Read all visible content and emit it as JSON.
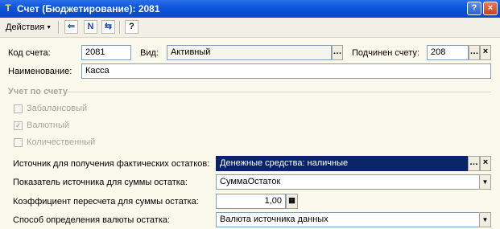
{
  "window": {
    "title": "Счет (Бюджетирование): 2081",
    "app_icon": "1C-app-icon"
  },
  "toolbar": {
    "actions_label": "Действия",
    "icons": [
      "back-icon",
      "structure-icon",
      "switch-icon",
      "help-icon"
    ],
    "help_glyph": "?"
  },
  "form": {
    "code": {
      "label": "Код счета:",
      "value": "2081"
    },
    "kind": {
      "label": "Вид:",
      "value": "Активный"
    },
    "parent": {
      "label": "Подчинен счету:",
      "value": "208"
    },
    "name": {
      "label": "Наименование:",
      "value": "Касса"
    },
    "accounting": {
      "title": "Учет по счету",
      "offbalance": {
        "label": "Забалансовый",
        "checked": false
      },
      "currency": {
        "label": "Валютный",
        "checked": true
      },
      "quantity": {
        "label": "Количественный",
        "checked": false
      }
    },
    "source": {
      "label": "Источник для получения фактических остатков:",
      "value": "Денежные средства: наличные"
    },
    "indicator": {
      "label": "Показатель источника для суммы остатка:",
      "value": "СуммаОстаток"
    },
    "coefficient": {
      "label": "Коэффициент пересчета для суммы остатка:",
      "value": "1,00"
    },
    "currency_method": {
      "label": "Способ определения валюты остатка:",
      "value": "Валюта источника данных"
    }
  },
  "colors": {
    "titlebar": "#0a55dc",
    "selection": "#0a246a",
    "background": "#fbf9ec"
  }
}
